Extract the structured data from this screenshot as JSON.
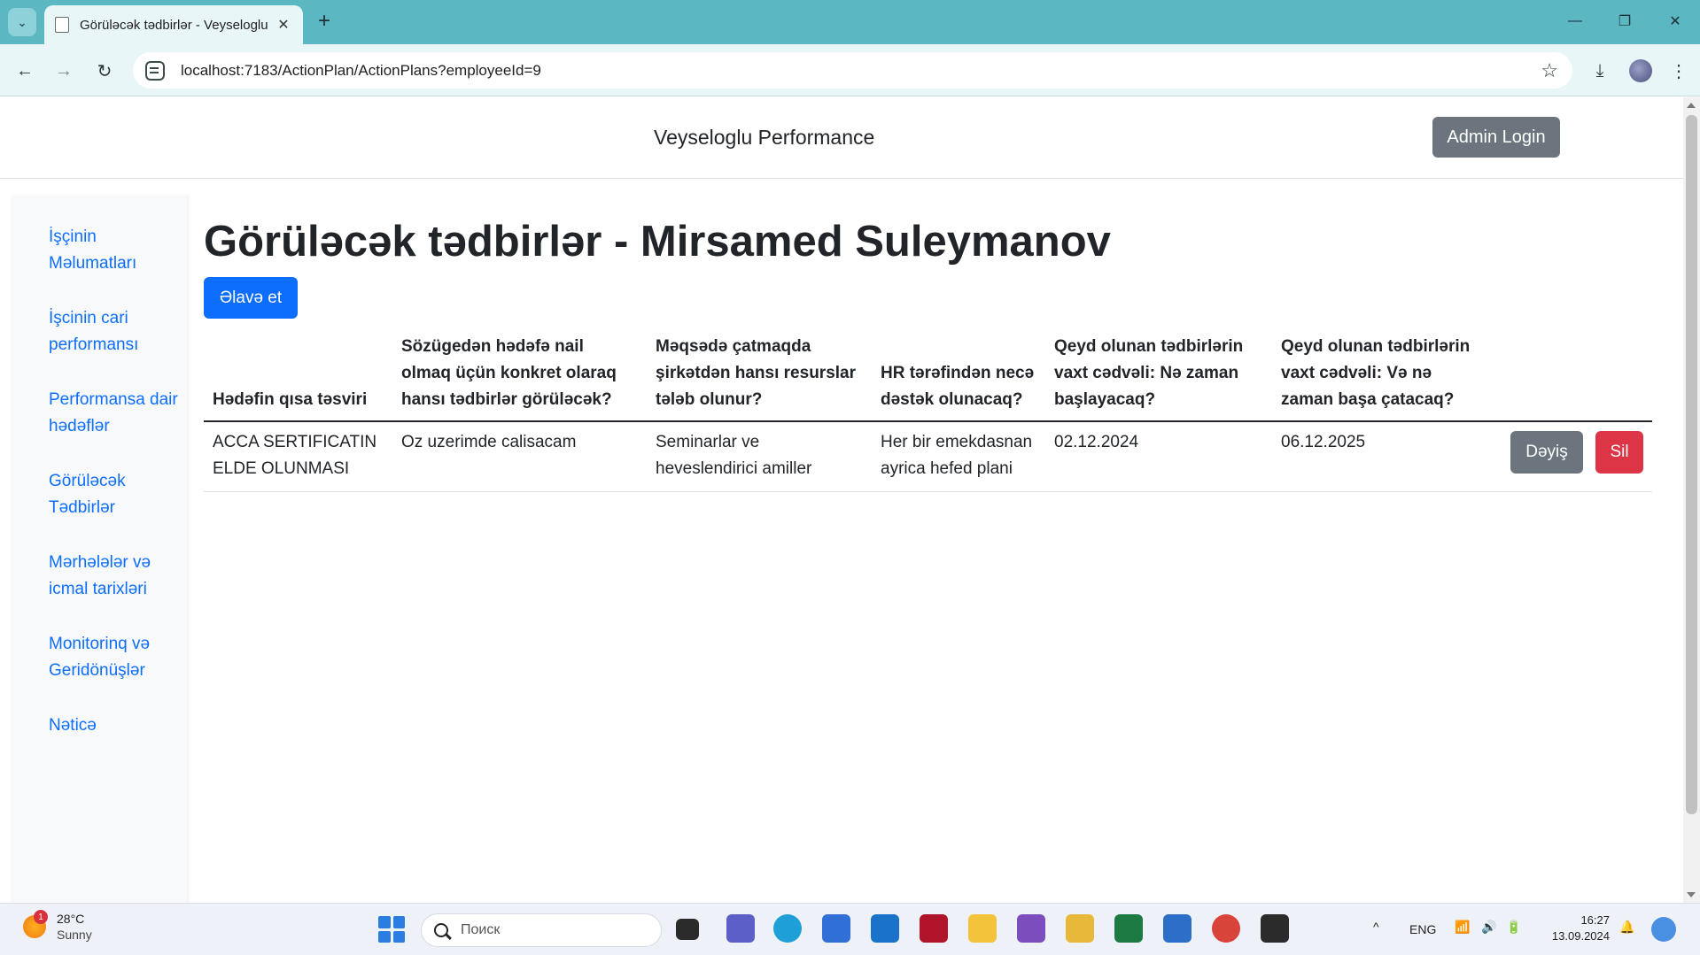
{
  "browser": {
    "tab_title": "Görüləcək tədbirlər - Veyseloglu",
    "url": "localhost:7183/ActionPlan/ActionPlans?employeeId=9",
    "new_tab_symbol": "+",
    "close_tab_symbol": "✕",
    "window_controls": {
      "minimize": "—",
      "restore": "❐",
      "close": "✕"
    },
    "nav": {
      "back": "←",
      "forward": "→",
      "reload": "↻",
      "star": "☆",
      "download": "⤓",
      "menu": "⋮"
    }
  },
  "header": {
    "brand": "Veyseloglu Performance",
    "admin_login": "Admin Login"
  },
  "sidebar": {
    "items": [
      {
        "label": "İşçinin Məlumatları"
      },
      {
        "label": "İşcinin cari performansı"
      },
      {
        "label": "Performansa dair hədəflər"
      },
      {
        "label": "Görüləcək Tədbirlər"
      },
      {
        "label": "Mərhələlər və icmal tarixləri"
      },
      {
        "label": "Monitorinq və Geridönüşlər"
      },
      {
        "label": "Nəticə"
      }
    ]
  },
  "main": {
    "title": "Görüləcək tədbirlər - Mirsamed Suleymanov",
    "add_button": "Əlavə et",
    "table": {
      "headers": [
        "Hədəfin qısa təsviri",
        "Sözügedən hədəfə nail olmaq üçün konkret olaraq hansı tədbirlər görüləcək?",
        "Məqsədə çatmaqda şirkətdən hansı resurslar tələb olunur?",
        "HR tərəfindən necə dəstək olunacaq?",
        "Qeyd olunan tədbirlərin vaxt cədvəli: Nə zaman başlayacaq?",
        "Qeyd olunan tədbirlərin vaxt cədvəli: Və nə zaman başa çatacaq?"
      ],
      "rows": [
        {
          "cells": [
            "ACCA SERTIFICATIN ELDE OLUNMASI",
            "Oz uzerimde calisacam",
            "Seminarlar ve heveslendirici amiller",
            "Her bir emekdasnan ayrica hefed plani",
            "02.12.2024",
            "06.12.2025"
          ],
          "edit_label": "Dəyiş",
          "delete_label": "Sil"
        }
      ]
    }
  },
  "taskbar": {
    "weather_temp": "28°C",
    "weather_cond": "Sunny",
    "weather_badge": "1",
    "search_placeholder": "Поиск",
    "language": "ENG",
    "time": "16:27",
    "date": "13.09.2024"
  },
  "colors": {
    "chrome_tab_strip": "#5bb8c3",
    "chrome_toolbar": "#e8f6f8",
    "primary": "#0d6efd",
    "secondary": "#6c757d",
    "danger": "#dc3545",
    "link": "#0d6efd"
  }
}
